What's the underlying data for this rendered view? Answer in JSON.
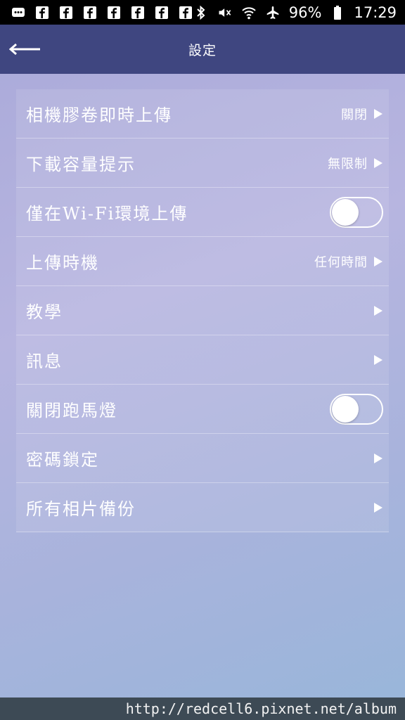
{
  "status_bar": {
    "notification_icons": [
      "facebook-icon",
      "facebook-icon",
      "facebook-icon",
      "facebook-icon",
      "facebook-icon",
      "facebook-icon",
      "facebook-icon"
    ],
    "battery_percent": "96%",
    "time": "17:29"
  },
  "app_bar": {
    "title": "設定"
  },
  "settings": {
    "items": [
      {
        "label": "相機膠卷即時上傳",
        "value": "關閉",
        "type": "nav"
      },
      {
        "label": "下載容量提示",
        "value": "無限制",
        "type": "nav"
      },
      {
        "label": "僅在Wi-Fi環境上傳",
        "type": "toggle",
        "on": false
      },
      {
        "label": "上傳時機",
        "value": "任何時間",
        "type": "nav"
      },
      {
        "label": "教學",
        "type": "nav"
      },
      {
        "label": "訊息",
        "type": "nav"
      },
      {
        "label": "關閉跑馬燈",
        "type": "toggle",
        "on": false
      },
      {
        "label": "密碼鎖定",
        "type": "nav"
      },
      {
        "label": "所有相片備份",
        "type": "nav"
      }
    ]
  },
  "footer": {
    "url": "http://redcell6.pixnet.net/album"
  },
  "colors": {
    "app_bar": "#3f4680",
    "status_bar": "#000000",
    "text": "#ffffff"
  }
}
